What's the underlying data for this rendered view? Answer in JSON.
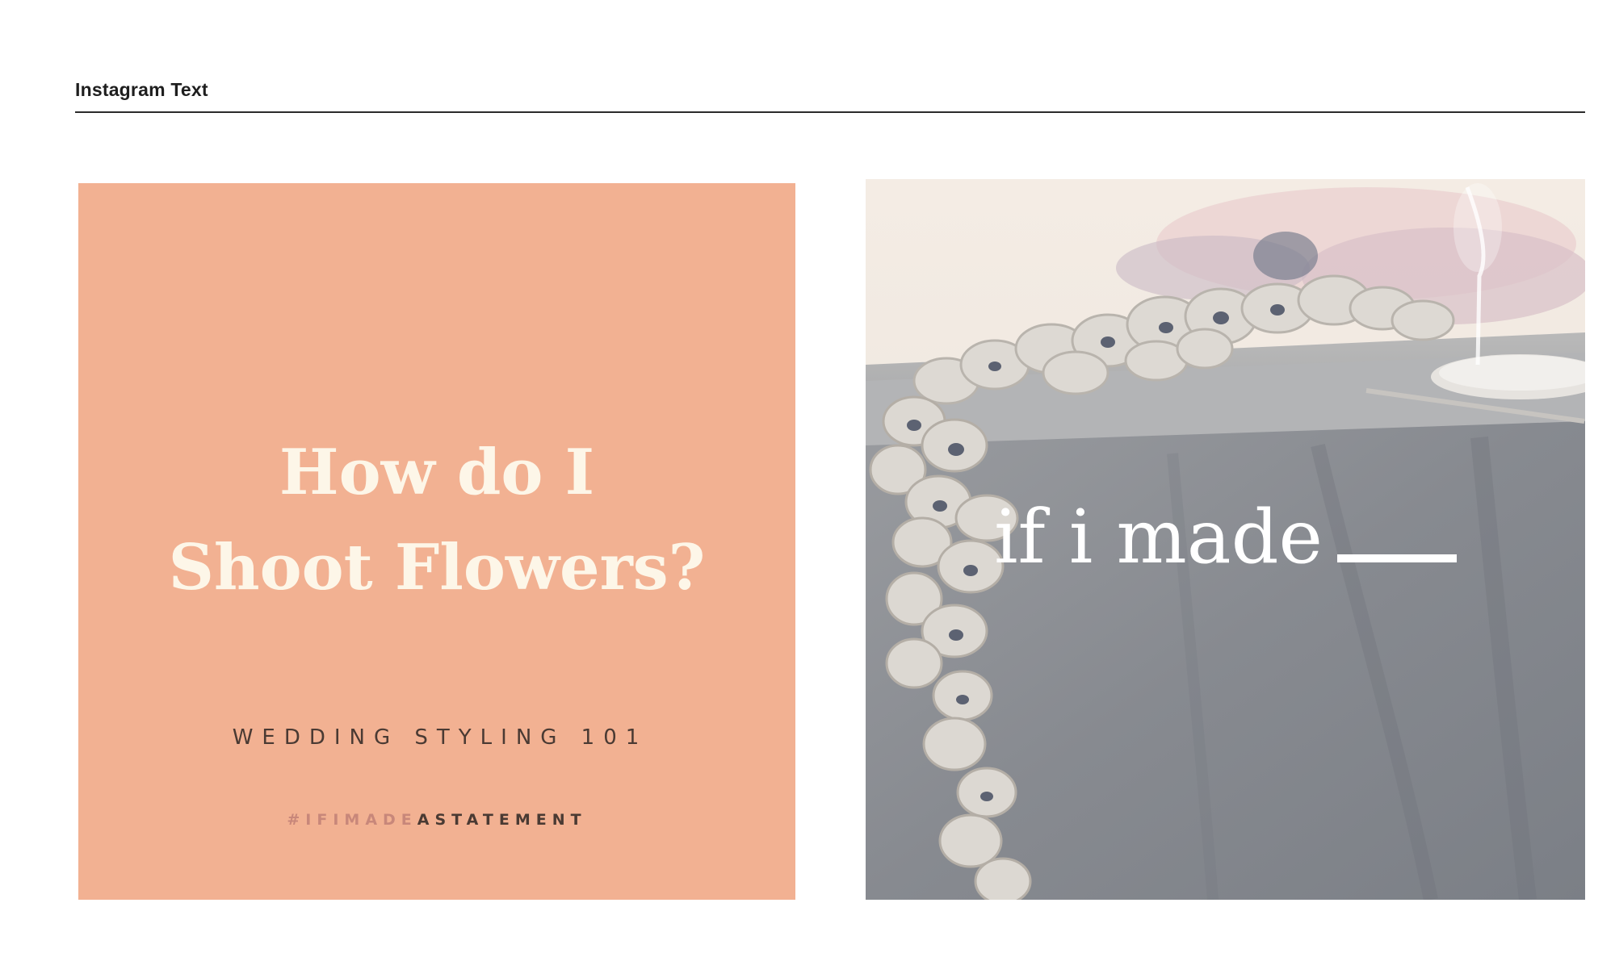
{
  "section": {
    "title": "Instagram Text"
  },
  "card_left": {
    "headline_line1": "How do I",
    "headline_line2": "Shoot Flowers?",
    "subhead": "WEDDING STYLING 101",
    "hashtag_part1": "#IFIMADE",
    "hashtag_part2": "ASTATEMENT",
    "background_color": "#f2b192"
  },
  "card_right": {
    "overlay_text": "if i made"
  }
}
